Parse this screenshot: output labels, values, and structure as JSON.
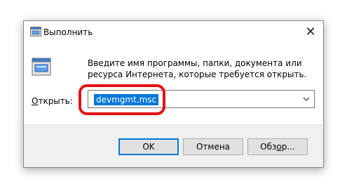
{
  "window": {
    "title": "Выполнить",
    "close_glyph": "✕"
  },
  "content": {
    "description": "Введите имя программы, папки, документа или ресурса Интернета, которые требуется открыть.",
    "open_label_accel": "О",
    "open_label_rest": "ткрыть:",
    "input_value": "devmgmt.msc"
  },
  "buttons": {
    "ok": "OK",
    "cancel": "Отмена",
    "browse_prefix": "Обз",
    "browse_accel": "о",
    "browse_suffix": "р..."
  },
  "colors": {
    "selection": "#0078d7",
    "highlight_ring": "#e21313"
  },
  "icons": {
    "title": "run-icon",
    "main": "run-icon-large",
    "dropdown": "chevron-down-icon"
  }
}
